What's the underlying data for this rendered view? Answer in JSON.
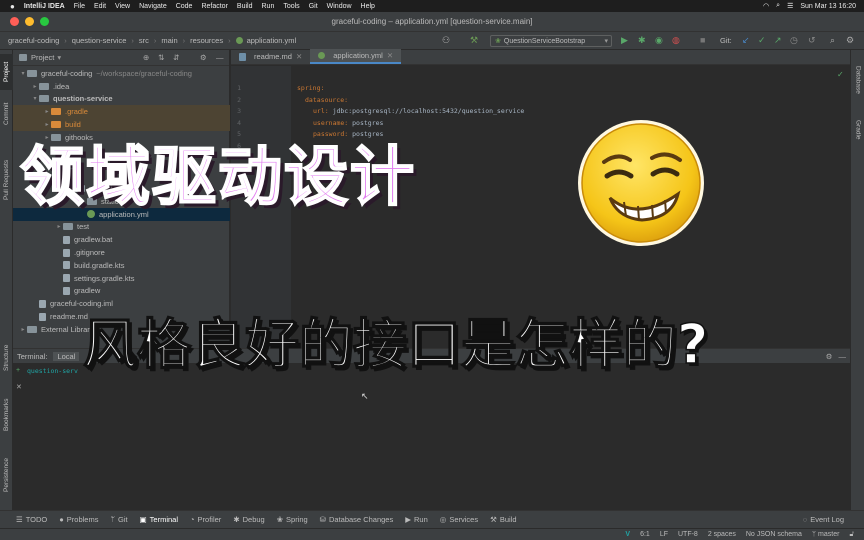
{
  "mac_menu": {
    "app": "IntelliJ IDEA",
    "items": [
      "File",
      "Edit",
      "View",
      "Navigate",
      "Code",
      "Refactor",
      "Build",
      "Run",
      "Tools",
      "Git",
      "Window",
      "Help"
    ],
    "datetime": "Sun Mar 13  16:20"
  },
  "window": {
    "title": "graceful-coding – application.yml [question-service.main]"
  },
  "breadcrumbs": [
    "graceful-coding",
    "question-service",
    "src",
    "main",
    "resources",
    "application.yml"
  ],
  "toolbar": {
    "run_config": "QuestionServiceBootstrap",
    "git_label": "Git:"
  },
  "project_panel": {
    "title": "Project",
    "tree": [
      {
        "label": "graceful-coding",
        "hint": "~/workspace/graceful-coding",
        "indent": 1,
        "type": "folder",
        "expanded": true
      },
      {
        "label": ".idea",
        "indent": 2,
        "type": "folder"
      },
      {
        "label": "question-service",
        "indent": 2,
        "type": "folder",
        "expanded": true,
        "bold": true
      },
      {
        "label": ".gradle",
        "indent": 3,
        "type": "folder-orange"
      },
      {
        "label": "build",
        "indent": 3,
        "type": "folder-orange"
      },
      {
        "label": "githooks",
        "indent": 3,
        "type": "folder"
      },
      {
        "label": "",
        "indent": 3,
        "type": "hidden"
      },
      {
        "label": "",
        "indent": 3,
        "type": "hidden"
      },
      {
        "label": "",
        "indent": 3,
        "type": "hidden"
      },
      {
        "label": "resources",
        "indent": 5,
        "type": "folder"
      },
      {
        "label": "static",
        "indent": 6,
        "type": "folder"
      },
      {
        "label": "application.yml",
        "indent": 6,
        "type": "yml",
        "selected": true
      },
      {
        "label": "test",
        "indent": 4,
        "type": "folder"
      },
      {
        "label": "gradlew.bat",
        "indent": 4,
        "type": "file"
      },
      {
        "label": ".gitignore",
        "indent": 4,
        "type": "file"
      },
      {
        "label": "build.gradle.kts",
        "indent": 4,
        "type": "file"
      },
      {
        "label": "settings.gradle.kts",
        "indent": 4,
        "type": "file"
      },
      {
        "label": "gradlew",
        "indent": 4,
        "type": "file"
      },
      {
        "label": "graceful-coding.iml",
        "indent": 2,
        "type": "file"
      },
      {
        "label": "readme.md",
        "indent": 2,
        "type": "file"
      },
      {
        "label": "External Libraries",
        "indent": 1,
        "type": "folder"
      }
    ]
  },
  "editor": {
    "tabs": [
      {
        "label": "readme.md",
        "active": false
      },
      {
        "label": "application.yml",
        "active": true
      }
    ],
    "lines": [
      {
        "n": "1",
        "key": "spring:",
        "val": "",
        "indent": 0
      },
      {
        "n": "2",
        "key": "datasource:",
        "val": "",
        "indent": 1
      },
      {
        "n": "3",
        "key": "url:",
        "val": " jdbc:postgresql://localhost:5432/question_service",
        "indent": 2
      },
      {
        "n": "4",
        "key": "username:",
        "val": " postgres",
        "indent": 2
      },
      {
        "n": "5",
        "key": "password:",
        "val": " postgres",
        "indent": 2
      },
      {
        "n": "6",
        "key": "",
        "val": "",
        "indent": 0
      }
    ]
  },
  "terminal": {
    "title": "Terminal:",
    "tab": "Local",
    "prompt": "question-serv"
  },
  "bottom_tools": [
    "TODO",
    "Problems",
    "Git",
    "Terminal",
    "Profiler",
    "Debug",
    "Spring",
    "Database Changes",
    "Run",
    "Services",
    "Build"
  ],
  "event_log": "Event Log",
  "status": {
    "position": "6:1",
    "line_ending": "LF",
    "encoding": "UTF-8",
    "indent": "2 spaces",
    "schema": "No JSON schema",
    "branch": "master"
  },
  "left_tabs": [
    "Project",
    "Commit",
    "Pull Requests",
    "Structure",
    "Bookmarks",
    "Persistence"
  ],
  "right_tabs": [
    "Database",
    "Gradle"
  ],
  "overlay": {
    "title_main": "领域驱动设计",
    "title_sub": "风格良好的接口是怎样的?"
  },
  "colors": {
    "accent": "#4a88c7",
    "title_main": "#e27af0",
    "emoji_face": "#f5c518"
  }
}
